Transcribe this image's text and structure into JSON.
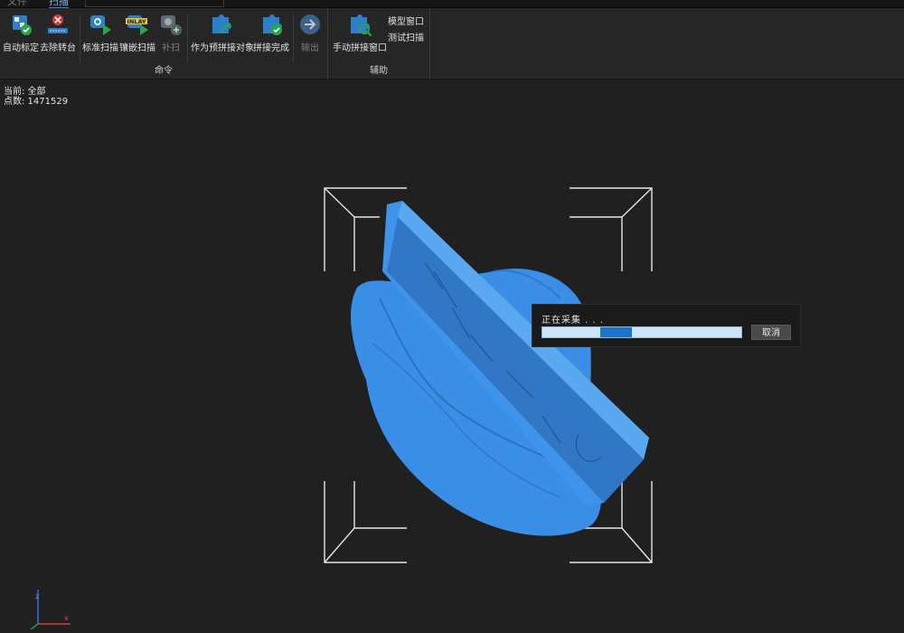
{
  "tabs": [
    {
      "label": "文件",
      "active": false
    },
    {
      "label": "扫描",
      "active": true
    }
  ],
  "ribbon": {
    "command_group": {
      "label": "命令",
      "tools": [
        {
          "label": "自动标定",
          "icon": "auto-calibrate-icon",
          "enabled": true
        },
        {
          "label": "去除转台",
          "icon": "remove-turntable-icon",
          "enabled": true
        },
        {
          "label": "标准扫描",
          "icon": "standard-scan-icon",
          "enabled": true
        },
        {
          "label": "镶嵌扫描",
          "icon": "inlay-scan-icon",
          "enabled": true,
          "badge": "INLAY"
        },
        {
          "label": "补扫",
          "icon": "supplement-scan-icon",
          "enabled": false
        },
        {
          "label": "作为预拼接对象",
          "icon": "pre-stitch-icon",
          "enabled": true
        },
        {
          "label": "拼接完成",
          "icon": "stitch-done-icon",
          "enabled": true
        },
        {
          "label": "输出",
          "icon": "export-icon",
          "enabled": false
        }
      ]
    },
    "assist_group": {
      "label": "辅助",
      "tools": [
        {
          "label": "手动拼接窗口",
          "icon": "manual-stitch-icon",
          "enabled": true
        }
      ],
      "small_buttons": [
        {
          "label": "模型窗口"
        },
        {
          "label": "测试扫描"
        }
      ]
    }
  },
  "info": {
    "current": "当前: 全部",
    "points": "点数: 1471529"
  },
  "progress": {
    "label": "正在采集 . . .",
    "cancel_label": "取消"
  },
  "axes": {
    "z_label": "z",
    "x_label": "x"
  },
  "colors": {
    "accent": "#2e86d6",
    "model": "#3a8ee6",
    "progress_fill": "#1d74c9",
    "progress_track": "#cde6f7"
  }
}
